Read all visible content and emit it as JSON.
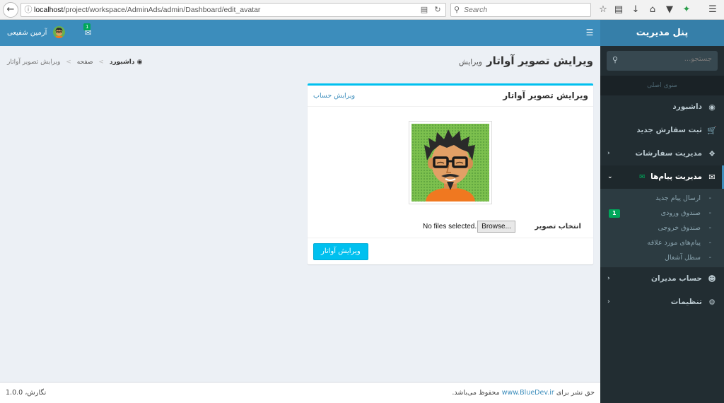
{
  "browser": {
    "url_host": "localhost",
    "url_path": "/project/workspace/AdminAds/admin/Dashboard/edit_avatar",
    "search_placeholder": "Search"
  },
  "sidebar": {
    "brand": "پنل مدیریت",
    "search_placeholder": "جستجو...",
    "header": "منوی اصلی",
    "items": [
      {
        "label": "داشبورد",
        "icon": "dashboard-icon"
      },
      {
        "label": "ثبت سفارش جدید",
        "icon": "cart-icon"
      },
      {
        "label": "مدیریت سفارشات",
        "icon": "cubes-icon"
      },
      {
        "label": "مدیریت پیام‌ها",
        "icon": "envelope-icon"
      },
      {
        "label": "حساب مدیران",
        "icon": "user-circle-icon"
      },
      {
        "label": "تنظیمات",
        "icon": "gear-icon"
      }
    ],
    "submenu": [
      {
        "label": "ارسال پیام جدید"
      },
      {
        "label": "صندوق ورودی",
        "badge": "1"
      },
      {
        "label": "صندوق خروجی"
      },
      {
        "label": "پیام‌های مورد علاقه"
      },
      {
        "label": "سطل آشغال"
      }
    ]
  },
  "navbar": {
    "username": "آرمین شفیعی",
    "mail_badge": "1"
  },
  "page": {
    "title": "ویرایش تصویر آواتار",
    "subtitle": "ویرایش",
    "breadcrumb": [
      "داشبورد",
      "صفحه",
      "ویرایش تصویر آواتار"
    ]
  },
  "box": {
    "title": "ویرایش تصویر آواتار",
    "link": "ویرایش حساب",
    "file_label": "انتخاب تصویر",
    "file_button": "Browse...",
    "file_status": "No files selected.",
    "submit": "ویرایش آواتار"
  },
  "footer": {
    "copyright_prefix": "حق نشر برای",
    "copyright_link": "www.BlueDev.ir",
    "copyright_suffix": "محفوظ می‌باشد.",
    "version": "نگارش، 1.0.0"
  },
  "colors": {
    "navbar": "#3c8dbc",
    "brand": "#367fa9",
    "sidebar": "#222d32",
    "accent": "#00c0ef",
    "badge": "#00a65a"
  }
}
